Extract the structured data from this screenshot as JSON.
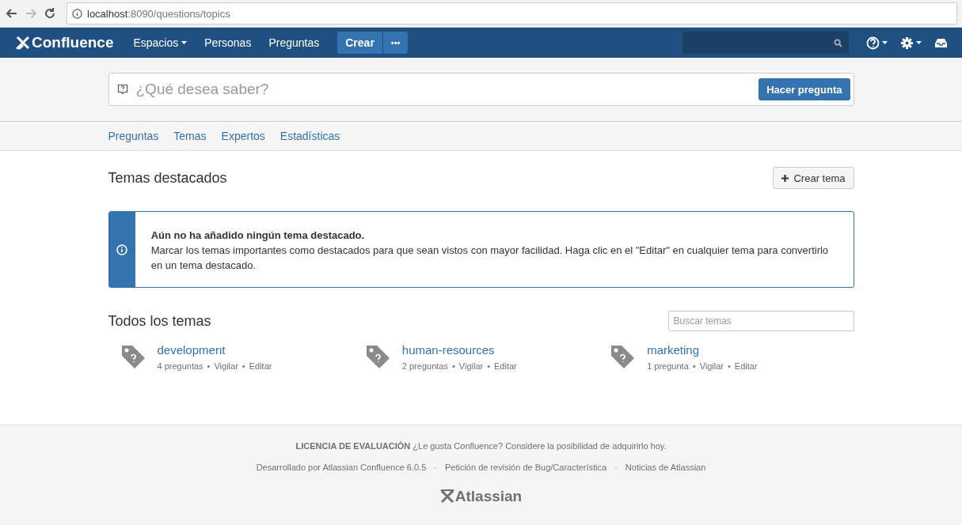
{
  "browser": {
    "url_host": "localhost",
    "url_path": ":8090/questions/topics"
  },
  "topbar": {
    "logo": "Confluence",
    "nav": [
      {
        "label": "Espacios",
        "dropdown": true
      },
      {
        "label": "Personas",
        "dropdown": false
      },
      {
        "label": "Preguntas",
        "dropdown": false
      }
    ],
    "create": "Crear",
    "more": "•••"
  },
  "ask": {
    "placeholder": "¿Qué desea saber?",
    "button": "Hacer pregunta"
  },
  "tabs": [
    "Preguntas",
    "Temas",
    "Expertos",
    "Estadísticas"
  ],
  "featured": {
    "title": "Temas destacados",
    "button": "Crear tema",
    "notice_title": "Aún no ha añadido ningún tema destacado.",
    "notice_text": "Marcar los temas importantes como destacados para que sean vistos con mayor facilidad. Haga clic en el \"Editar\" en cualquier tema para convertirlo en un tema destacado."
  },
  "all": {
    "title": "Todos los temas",
    "search_placeholder": "Buscar temas",
    "separator": "•",
    "topics": [
      {
        "name": "development",
        "count": "4 preguntas",
        "watch": "Vigilar",
        "edit": "Editar"
      },
      {
        "name": "human-resources",
        "count": "2 preguntas",
        "watch": "Vigilar",
        "edit": "Editar"
      },
      {
        "name": "marketing",
        "count": "1 pregunta",
        "watch": "Vigilar",
        "edit": "Editar"
      }
    ]
  },
  "footer": {
    "license": "**LICENCIA DE EVALUACIÓN** ¿Le gusta Confluence? Considere la posibilidad de adquirirlo hoy.",
    "separator": "·",
    "links": [
      "Desarrollado por Atlassian Confluence 6.0.5",
      "Petición de revisión de Bug/Característica",
      "Noticias de Atlassian"
    ],
    "logo": "Atlassian"
  }
}
